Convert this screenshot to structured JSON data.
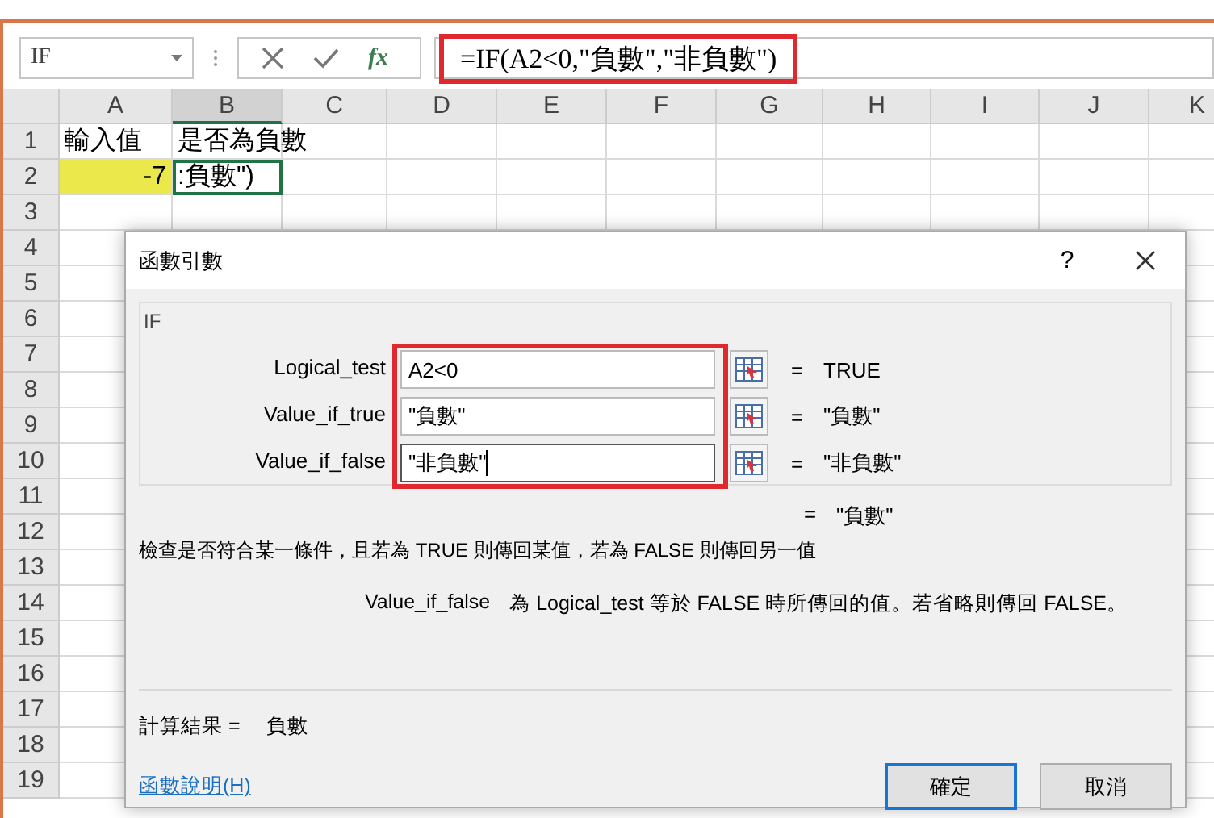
{
  "name_box": {
    "value": "IF"
  },
  "formula_bar": {
    "function_label": "fx",
    "value": "=IF(A2<0,\"負數\",\"非負數\")",
    "highlighted": true
  },
  "columns": [
    {
      "label": "A",
      "selected": false
    },
    {
      "label": "B",
      "selected": true
    },
    {
      "label": "C",
      "selected": false
    },
    {
      "label": "D",
      "selected": false
    },
    {
      "label": "E",
      "selected": false
    },
    {
      "label": "F",
      "selected": false
    },
    {
      "label": "G",
      "selected": false
    },
    {
      "label": "H",
      "selected": false
    },
    {
      "label": "I",
      "selected": false
    },
    {
      "label": "J",
      "selected": false
    },
    {
      "label": "K",
      "selected": false
    }
  ],
  "rows": [
    {
      "header": "1",
      "cells": [
        {
          "value": "輸入值",
          "selected": false,
          "highlighted": false,
          "kind": "text"
        },
        {
          "value": "是否為負數",
          "selected": false,
          "highlighted": false,
          "kind": "text"
        }
      ]
    },
    {
      "header": "2",
      "cells": [
        {
          "value": "-7",
          "selected": false,
          "highlighted": true,
          "kind": "number"
        },
        {
          "value": ":負數\")",
          "selected": true,
          "highlighted": false,
          "kind": "text"
        }
      ]
    },
    {
      "header": "3"
    },
    {
      "header": "4"
    },
    {
      "header": "5"
    },
    {
      "header": "6"
    },
    {
      "header": "7"
    },
    {
      "header": "8"
    },
    {
      "header": "9"
    },
    {
      "header": "10"
    },
    {
      "header": "11"
    },
    {
      "header": "12"
    },
    {
      "header": "13"
    },
    {
      "header": "14"
    },
    {
      "header": "15"
    },
    {
      "header": "16"
    },
    {
      "header": "17"
    },
    {
      "header": "18"
    },
    {
      "header": "19"
    }
  ],
  "dialog": {
    "title": "函數引數",
    "help": "?",
    "group": "IF",
    "args_highlighted": true,
    "args": [
      {
        "label": "Logical_test",
        "value": "A2<0",
        "focused": false,
        "equals": "=",
        "result": "TRUE"
      },
      {
        "label": "Value_if_true",
        "value": "\"負數\"",
        "focused": false,
        "equals": "=",
        "result": "\"負數\""
      },
      {
        "label": "Value_if_false",
        "value": "\"非負數\"",
        "focused": true,
        "equals": "=",
        "result": "\"非負數\""
      }
    ],
    "formula_equals": "=",
    "formula_result": "\"負數\"",
    "description": "檢查是否符合某一條件，且若為 TRUE 則傳回某值，若為 FALSE 則傳回另一值",
    "arg_name": "Value_if_false",
    "arg_description": "為 Logical_test 等於 FALSE 時所傳回的值。若省略則傳回 FALSE。",
    "result_label": "計算結果 =",
    "result_value": "負數",
    "help_link": "函數說明(H)",
    "buttons": [
      {
        "label": "確定",
        "default": true
      },
      {
        "label": "取消",
        "default": false
      }
    ]
  }
}
